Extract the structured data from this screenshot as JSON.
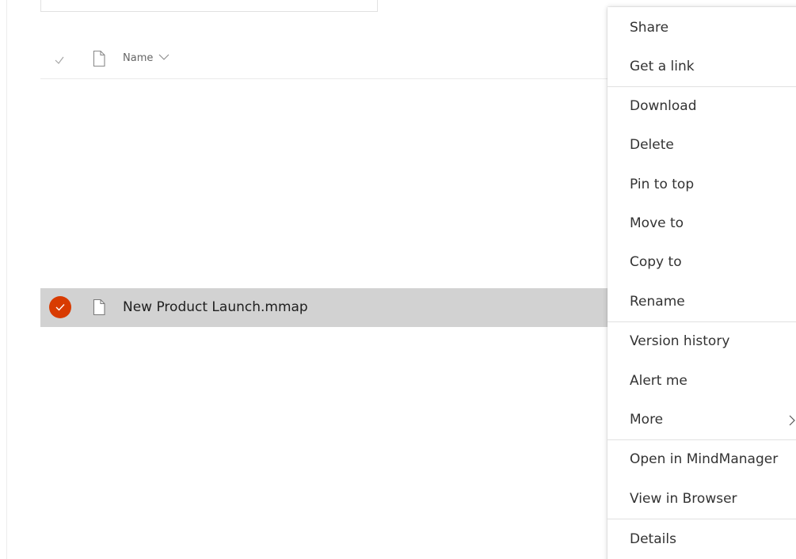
{
  "list": {
    "header": {
      "name_label": "Name"
    },
    "rows": [
      {
        "name": "New Product Launch.mmap",
        "selected": true
      }
    ]
  },
  "context_menu": {
    "items": [
      {
        "label": "Share"
      },
      {
        "label": "Get a link"
      },
      {
        "label": "Download"
      },
      {
        "label": "Delete"
      },
      {
        "label": "Pin to top"
      },
      {
        "label": "Move to"
      },
      {
        "label": "Copy to"
      },
      {
        "label": "Rename"
      },
      {
        "label": "Version history"
      },
      {
        "label": "Alert me"
      },
      {
        "label": "More",
        "has_submenu": true
      },
      {
        "label": "Open in MindManager"
      },
      {
        "label": "View in Browser"
      },
      {
        "label": "Details"
      }
    ]
  },
  "colors": {
    "accent": "#d83b01",
    "selected_row": "#d2d2d2"
  }
}
